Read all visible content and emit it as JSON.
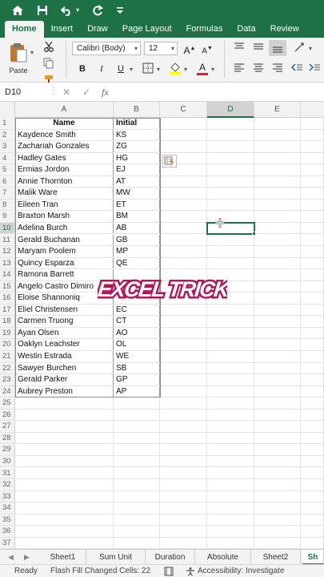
{
  "titlebar": {
    "icons": [
      "home-icon",
      "save-icon",
      "undo-icon",
      "undo-dropdown-icon",
      "redo-icon",
      "customize-dropdown-icon"
    ]
  },
  "ribbon_tabs": [
    "Home",
    "Insert",
    "Draw",
    "Page Layout",
    "Formulas",
    "Data",
    "Review"
  ],
  "active_tab": "Home",
  "ribbon": {
    "paste_label": "Paste",
    "font_name": "Calibri (Body)",
    "font_size": "12",
    "grow_font": "A",
    "shrink_font": "A",
    "bold": "B",
    "italic": "I",
    "underline": "U",
    "font_color_letter": "A",
    "fill_color": "#ffff00",
    "font_color": "#e02020"
  },
  "formula_bar": {
    "name_box": "D10",
    "cancel": "✕",
    "enter": "✓",
    "fx": "fx",
    "value": ""
  },
  "columns": [
    "A",
    "B",
    "C",
    "D",
    "E"
  ],
  "selected_column": "D",
  "selected_row": "10",
  "table": {
    "headers": [
      "Name",
      "Initial"
    ],
    "rows": [
      [
        "Kaydence Smith",
        "KS"
      ],
      [
        "Zachariah Gonzales",
        "ZG"
      ],
      [
        "Hadley Gates",
        "HG"
      ],
      [
        "Ermias Jordon",
        "EJ"
      ],
      [
        "Annie Thornton",
        "AT"
      ],
      [
        "Malik Ware",
        "MW"
      ],
      [
        "Eileen Tran",
        "ET"
      ],
      [
        "Braxton Marsh",
        "BM"
      ],
      [
        "Adelina Burch",
        "AB"
      ],
      [
        "Gerald Buchanan",
        "GB"
      ],
      [
        "Maryam Poolem",
        "MP"
      ],
      [
        "Quincy Esparza",
        "QE"
      ],
      [
        "Ramona Barrett",
        ""
      ],
      [
        "Angelo Castro Dimiro",
        ""
      ],
      [
        "Eloise Shannoniq",
        ""
      ],
      [
        "Eliel Christensen",
        "EC"
      ],
      [
        "Carmen Truong",
        "CT"
      ],
      [
        "Ayan Olsen",
        "AO"
      ],
      [
        "Oaklyn Leachster",
        "OL"
      ],
      [
        "Westin Estrada",
        "WE"
      ],
      [
        "Sawyer Burchen",
        "SB"
      ],
      [
        "Gerald Parker",
        "GP"
      ],
      [
        "Aubrey Preston",
        "AP"
      ]
    ]
  },
  "row_numbers": [
    "1",
    "2",
    "3",
    "4",
    "5",
    "6",
    "7",
    "8",
    "9",
    "10",
    "11",
    "12",
    "13",
    "14",
    "15",
    "16",
    "17",
    "18",
    "19",
    "20",
    "21",
    "22",
    "23",
    "24",
    "25",
    "26",
    "27",
    "28",
    "29",
    "30",
    "31",
    "32",
    "33",
    "34",
    "35",
    "36",
    "37"
  ],
  "overlay_text": "EXCEL TRICK",
  "sheet_tabs": [
    "Sheet1",
    "Sum Unit",
    "Duration",
    "Absolute",
    "Sheet2",
    "Sh"
  ],
  "active_sheet": "Sh",
  "status": {
    "ready": "Ready",
    "flash_fill": "Flash Fill Changed Cells: 22",
    "accessibility": "Accessibility: Investigate"
  },
  "colors": {
    "excel_green": "#1e7145",
    "overlay_fill": "#ffffff",
    "overlay_outline": "#b0185c"
  }
}
